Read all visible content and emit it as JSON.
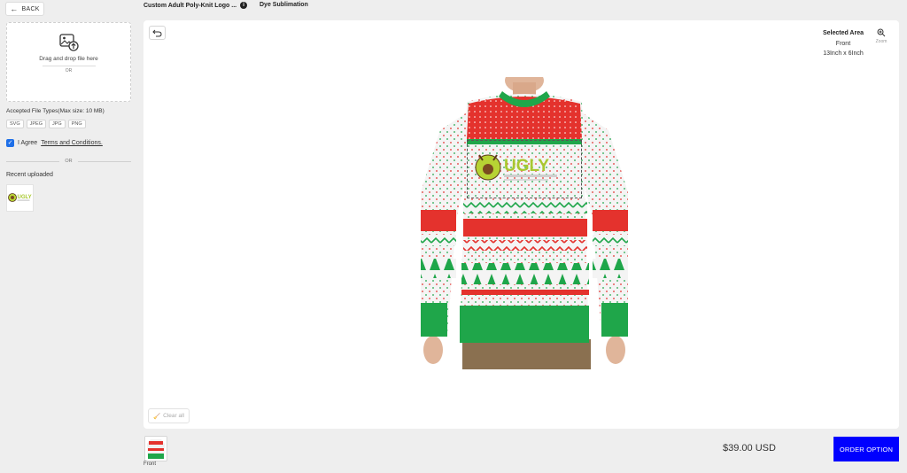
{
  "left_panel": {
    "back_label": "BACK",
    "dropzone_text": "Drag and drop file here",
    "dropzone_or": "OR",
    "accepted_label": "Accepted File Types(Max size: 10 MB)",
    "file_types": [
      "SVG",
      "JPEG",
      "JPG",
      "PNG"
    ],
    "agree_prefix": "I Agree",
    "terms_link": "Terms and Conditions.",
    "agree_checked": true,
    "or_label": "OR",
    "recent_label": "Recent uploaded"
  },
  "header": {
    "product_title": "Custom Adult Poly-Knit Logo ...",
    "method": "Dye Sublimation"
  },
  "canvas": {
    "selected_area_title": "Selected Area",
    "selected_area_side": "Front",
    "selected_area_size": "13Inch x 6Inch",
    "zoom_label": "Zoom",
    "clear_all_label": "Clear all",
    "logo_text": "UGLY"
  },
  "footer": {
    "view_label": "Front",
    "price": "$39.00 USD",
    "order_button": "ORDER OPTION"
  },
  "colors": {
    "accent_blue": "#0000ff",
    "checkbox_blue": "#1e6fe8",
    "sweater_green": "#1fa64a",
    "sweater_red": "#e4322d"
  }
}
